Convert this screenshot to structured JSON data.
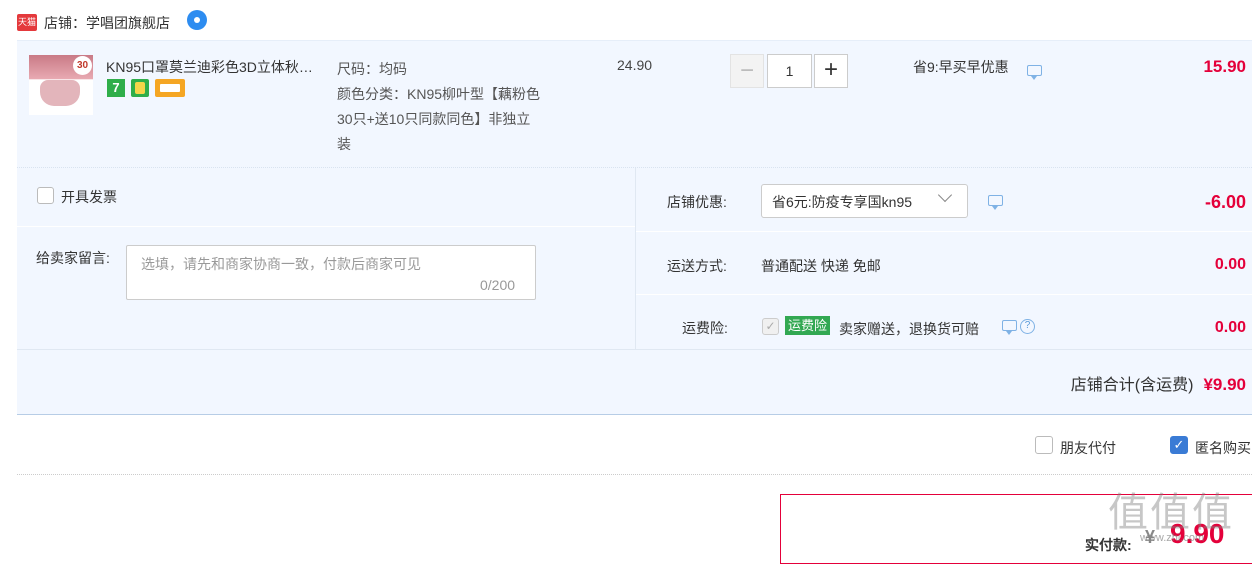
{
  "shop": {
    "logo_text": "天猫",
    "label": "店铺：学唱团旗舰店"
  },
  "item": {
    "thumb_badge": "30",
    "title": "KN95口罩莫兰迪彩色3D立体秋…",
    "sku_size": "尺码：均码",
    "sku_color_lines": [
      "颜色分类：KN95柳叶型【藕粉色",
      "30只+送10只同款同色】非独立",
      "装"
    ],
    "badge_7": "7",
    "price": "24.90",
    "qty": {
      "minus": "−",
      "value": "1",
      "plus": "+"
    },
    "promo": "省9:早买早优惠",
    "subtotal": "15.90"
  },
  "options": {
    "invoice_label": "开具发票",
    "invoice_checked": false,
    "message_label": "给卖家留言:",
    "message_placeholder": "选填，请先和商家协商一致，付款后商家可见",
    "message_count": "0/200",
    "store_discount_label": "店铺优惠:",
    "store_discount_select": "省6元:防疫专享国kn95",
    "store_discount_amount": "-6.00",
    "shipping_label": "运送方式:",
    "shipping_value": "普通配送 快递 免邮",
    "shipping_amount": "0.00",
    "insurance_label": "运费险:",
    "insurance_tag": "运费险",
    "insurance_text": "卖家赠送，退换货可赔",
    "insurance_amount": "0.00",
    "help_mark": "?",
    "store_total_label": "店铺合计(含运费)",
    "store_total_amount": "¥9.90"
  },
  "bottom": {
    "friend_pay_label": "朋友代付",
    "friend_pay_checked": false,
    "anonymous_label": "匿名购买",
    "anonymous_checked": true,
    "pay_label": "实付款:",
    "pay_yen": "¥",
    "pay_amount": "9.90"
  },
  "watermark": {
    "text": "值值值",
    "url": "www.zhi.com"
  },
  "colors": {
    "accent": "#e4003a",
    "panel_bg": "#f2f7ff",
    "brand_blue": "#3a7bd5",
    "insurance_green": "#32a852"
  },
  "icons": [
    "tmall-logo-icon",
    "wangwang-icon",
    "chat-icon",
    "help-icon",
    "chevron-down-icon",
    "checkbox-icon"
  ]
}
